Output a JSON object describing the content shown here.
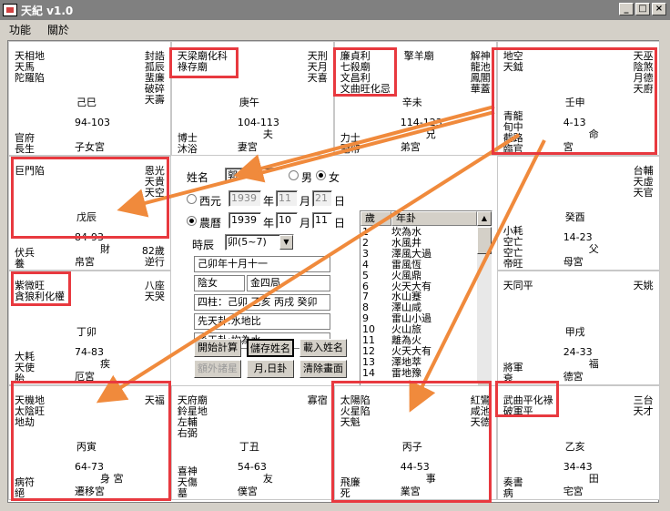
{
  "window": {
    "title": "天紀 v1.0",
    "min": "_",
    "max": "□",
    "close": "×"
  },
  "menu": [
    "功能",
    "關於"
  ],
  "palaces": [
    {
      "stars": [
        "天相地",
        "天馬",
        "陀羅陷"
      ],
      "right": [
        "封誥",
        "孤辰",
        "蜚廉",
        "破碎",
        "天壽"
      ],
      "branch": "己巳",
      "range": "94-103",
      "p1": "官府",
      "p2": "長生",
      "house": "子女宮",
      "sfx": ""
    },
    {
      "stars": [
        "天梁廟化科",
        "祿存廟"
      ],
      "right": [
        "天刑",
        "天月",
        "天喜"
      ],
      "branch": "庚午",
      "range": "104-113",
      "p1": "博士",
      "p2": "沐浴",
      "house": "妻宮",
      "sfx": "夫"
    },
    {
      "stars": [
        "廉貞利",
        "七殺廟",
        "文昌利",
        "文曲旺化忌"
      ],
      "mid": [
        "擎羊廟"
      ],
      "right": [
        "解神",
        "龍池",
        "鳳閣",
        "華蓋"
      ],
      "branch": "辛未",
      "range": "114-123",
      "p1": "力士",
      "p2": "冠帶",
      "house": "弟宮",
      "sfx": "兄"
    },
    {
      "stars": [
        "地空",
        "天鉞"
      ],
      "right": [
        "天巫",
        "陰煞",
        "月德",
        "天廚"
      ],
      "branch": "壬申",
      "range": "4-13",
      "p1": "青龍",
      "p2": "旬中",
      "p3": "截路",
      "p4": "臨官",
      "house": "宮",
      "sfx": "命"
    },
    {
      "stars": [
        "巨門陷"
      ],
      "right": [
        "恩光",
        "天貴",
        "天空"
      ],
      "branch": "戊辰",
      "range": "84-93",
      "p1": "伏兵",
      "p2": "養",
      "house": "帛宮",
      "sfx": "財",
      "extra": [
        "82歲",
        "逆行"
      ]
    },
    {
      "stars": [],
      "right": [
        "台輔",
        "天虛",
        "天官"
      ],
      "branch": "癸酉",
      "range": "14-23",
      "p1": "小耗",
      "p2": "空亡",
      "p3": "空亡",
      "p4": "帝旺",
      "house": "母宮",
      "sfx": "父"
    },
    {
      "stars": [
        "紫微旺",
        "貪狼利化權"
      ],
      "right": [
        "八座",
        "天哭"
      ],
      "branch": "丁卯",
      "range": "74-83",
      "p1": "大耗",
      "p2": "天使",
      "p3": "胎",
      "house": "厄宮",
      "sfx": "疾"
    },
    {
      "stars": [
        "天同平"
      ],
      "right": [
        "天姚"
      ],
      "branch": "甲戌",
      "range": "24-33",
      "p1": "將軍",
      "p2": "衰",
      "house": "德宮",
      "sfx": "福"
    },
    {
      "stars": [
        "天機地",
        "太陰旺",
        "地劫"
      ],
      "right": [
        "天福"
      ],
      "branch": "丙寅",
      "range": "64-73",
      "p1": "病符",
      "p2": "絕",
      "house": "遷移宮",
      "sfx": "身 宮"
    },
    {
      "stars": [
        "天府廟",
        "鈴星地",
        "左輔",
        "右弼"
      ],
      "right": [
        "寡宿"
      ],
      "branch": "丁丑",
      "range": "54-63",
      "p1": "喜神",
      "p2": "天傷",
      "p3": "墓",
      "house": "僕宮",
      "sfx": "友"
    },
    {
      "stars": [
        "太陽陷",
        "火星陷",
        "天魁"
      ],
      "right": [
        "紅鸞",
        "咸池",
        "天德"
      ],
      "branch": "丙子",
      "range": "44-53",
      "p1": "飛廉",
      "p2": "死",
      "house": "業宮",
      "sfx": "事"
    },
    {
      "stars": [
        "武曲平化祿",
        "破軍平"
      ],
      "right": [
        "三台",
        "天才"
      ],
      "branch": "乙亥",
      "range": "34-43",
      "p1": "奏書",
      "p2": "病",
      "house": "宅宮",
      "sfx": "田"
    }
  ],
  "form": {
    "name_label": "姓名",
    "name_value": "郭",
    "male": "男",
    "female": "女",
    "west_label": "西元",
    "west_year": "1939",
    "west_month": "11",
    "west_day": "21",
    "year": "年",
    "month": "月",
    "day": "日",
    "lunar_label": "農曆",
    "lunar_year": "1939",
    "lunar_month": "10",
    "lunar_day": "11",
    "hour_label": "時辰",
    "hour_value": "卯(5~7)",
    "info1": "己卯年十月十一",
    "info2a": "陰女",
    "info2b": "金四局",
    "info3": "四柱：己卯 乙亥 丙戌 癸卯",
    "info4": "先天卦:水地比",
    "info5": "後天卦:坎為水"
  },
  "buttons": [
    "開始計算",
    "儲存姓名",
    "載入姓名",
    "額外諸星",
    "月,日卦",
    "清除畫面"
  ],
  "list": {
    "h1": "歲",
    "h2": "年卦",
    "rows": [
      [
        "1",
        "坎為水"
      ],
      [
        "2",
        "水風井"
      ],
      [
        "3",
        "澤風大過"
      ],
      [
        "4",
        "雷風恆"
      ],
      [
        "5",
        "火風鼎"
      ],
      [
        "6",
        "火天大有"
      ],
      [
        "7",
        "水山蹇"
      ],
      [
        "8",
        "澤山咸"
      ],
      [
        "9",
        "雷山小過"
      ],
      [
        "10",
        "火山旅"
      ],
      [
        "11",
        "離為火"
      ],
      [
        "12",
        "火天大有"
      ],
      [
        "13",
        "澤地萃"
      ],
      [
        "14",
        "雷地豫"
      ]
    ]
  },
  "colors": {
    "highlight": "#e8393f",
    "arrow": "#f08a3c"
  }
}
